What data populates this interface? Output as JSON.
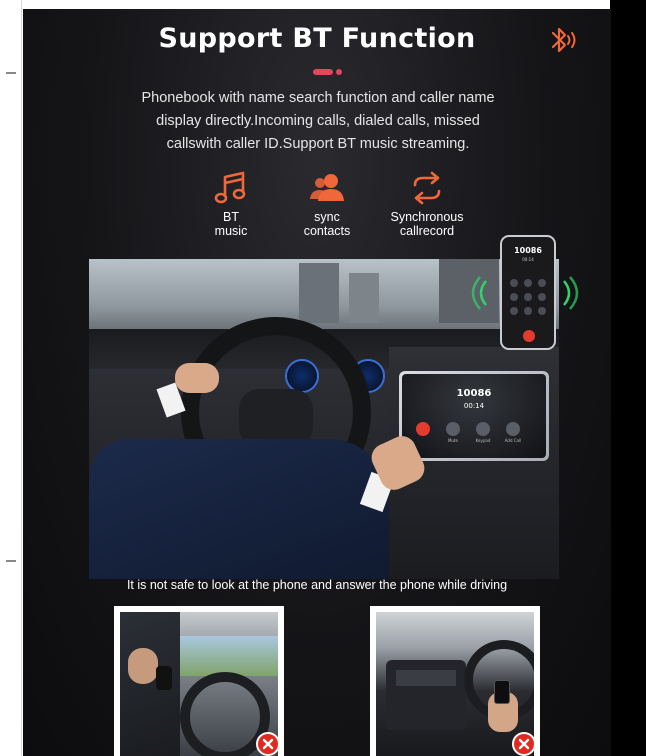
{
  "header": {
    "title": "Support BT Function",
    "icon": "bluetooth-audio-icon"
  },
  "description": {
    "line1": "Phonebook with name search function and caller name",
    "line2": "display directly.Incoming calls, dialed calls, missed",
    "line3": "callswith caller ID.Support BT music streaming."
  },
  "features": [
    {
      "icon": "music-note-icon",
      "line1": "BT",
      "line2": "music"
    },
    {
      "icon": "contacts-icon",
      "line1": "sync",
      "line2": "contacts"
    },
    {
      "icon": "sync-arrows-icon",
      "line1": "Synchronous",
      "line2": "callrecord"
    }
  ],
  "phone_screen": {
    "number": "10086",
    "time": "00:14"
  },
  "radio_screen": {
    "number": "10086",
    "time": "00:14",
    "buttons": [
      "Mute",
      "Keypad",
      "Add Call"
    ]
  },
  "warning": "It is not safe to look at the phone and answer the phone while driving",
  "examples": [
    {
      "scene": "driver-holding-phone-to-ear",
      "status": "not-allowed"
    },
    {
      "scene": "driver-holding-phone-while-steering",
      "status": "not-allowed"
    }
  ],
  "colors": {
    "accent": "#e5475a",
    "icon_orange": "#f0673a",
    "background": "#151518",
    "cross": "#e02a20",
    "wave_green": "#2fd46a"
  }
}
